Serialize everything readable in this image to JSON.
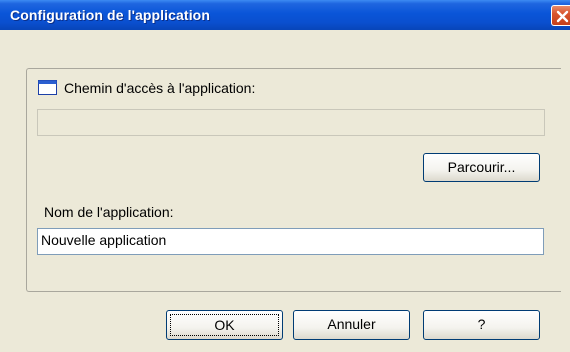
{
  "window": {
    "title": "Configuration de l'application"
  },
  "icons": {
    "close": "close-icon",
    "path_label": "window-icon"
  },
  "form": {
    "path_label": "Chemin d'accès à l'application:",
    "path_value": "",
    "browse_label": "Parcourir...",
    "name_label": "Nom de l'application:",
    "name_value": "Nouvelle application"
  },
  "buttons": {
    "ok_label": "OK",
    "cancel_label": "Annuler",
    "help_label": "?"
  },
  "colors": {
    "title_bar": "#0a55d8",
    "dialog_background": "#ece9d8",
    "close_button": "#d8552f"
  }
}
